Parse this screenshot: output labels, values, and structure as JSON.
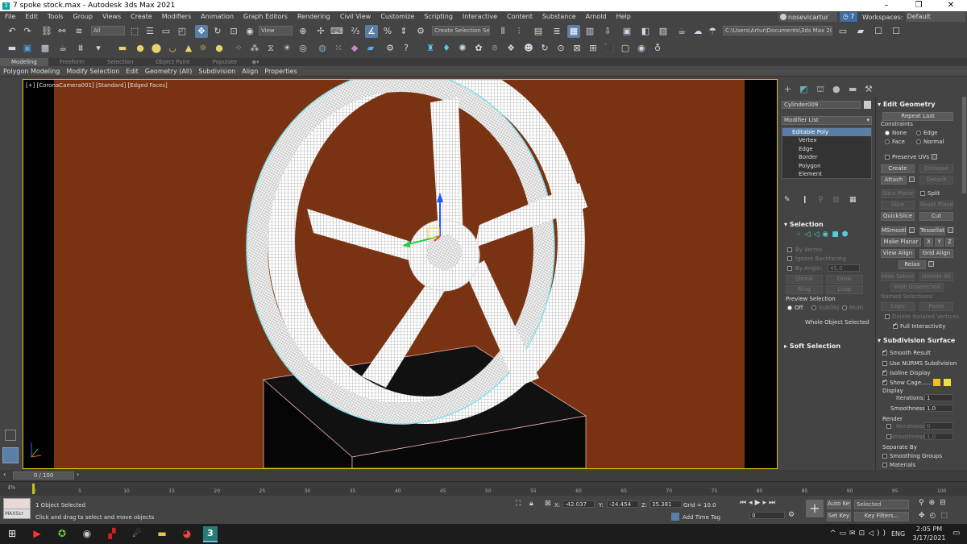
{
  "window": {
    "title": "7 spoke stock.max - Autodesk 3ds Max 2021",
    "controls": [
      "–",
      "❐",
      "✕"
    ]
  },
  "menu": [
    "File",
    "Edit",
    "Tools",
    "Group",
    "Views",
    "Create",
    "Modifiers",
    "Animation",
    "Graph Editors",
    "Rendering",
    "Civil View",
    "Customize",
    "Scripting",
    "Interactive",
    "Content",
    "Substance",
    "Arnold",
    "Help"
  ],
  "user": {
    "name": "nosevicartur",
    "help_count": "7",
    "workspaces_label": "Workspaces:",
    "workspace": "Default"
  },
  "toolbar": {
    "filter": "All",
    "refcoord": "View",
    "selection_set": "Create Selection Se",
    "path": "C:\\Users\\Artur\\Documents\\3ds Max 2021"
  },
  "ribbon": {
    "tabs": [
      "Modeling",
      "Freeform",
      "Selection",
      "Object Paint",
      "Populate"
    ],
    "items": [
      "Polygon Modeling",
      "Modify Selection",
      "Edit",
      "Geometry (All)",
      "Subdivision",
      "Align",
      "Properties"
    ]
  },
  "viewport": {
    "label": "[+] [CoronaCamera001] [Standard] [Edged Faces]"
  },
  "command_panel": {
    "object_name": "Cylinder009",
    "modifier_list": "Modifier List",
    "stack": [
      "Editable Poly",
      "Vertex",
      "Edge",
      "Border",
      "Polygon",
      "Element"
    ],
    "selection": {
      "title": "Selection",
      "by_vertex": "By Vertex",
      "ignore_backfacing": "Ignore Backfacing",
      "by_angle": "By Angle:",
      "angle": "45.0",
      "shrink": "Shrink",
      "grow": "Grow",
      "ring": "Ring",
      "loop": "Loop",
      "preview": "Preview Selection",
      "off": "Off",
      "subobj": "SubObj",
      "multi": "Multi",
      "status": "Whole Object Selected"
    },
    "soft_selection": "Soft Selection",
    "edit_geometry": {
      "title": "Edit Geometry",
      "repeat_last": "Repeat Last",
      "constraints": "Constraints",
      "none": "None",
      "edge": "Edge",
      "face": "Face",
      "normal": "Normal",
      "preserve_uvs": "Preserve UVs",
      "create": "Create",
      "collapse": "Collapse",
      "attach": "Attach",
      "detach": "Detach",
      "slice_plane": "Slice Plane",
      "split": "Split",
      "slice": "Slice",
      "reset_plane": "Reset Plane",
      "quickslice": "QuickSlice",
      "cut": "Cut",
      "msmooth": "MSmooth",
      "tessellate": "Tessellate",
      "make_planar": "Make Planar",
      "x": "X",
      "y": "Y",
      "z": "Z",
      "view_align": "View Align",
      "grid_align": "Grid Align",
      "relax": "Relax",
      "hide_selected": "Hide Selected",
      "unhide_all": "Unhide All",
      "hide_unselected": "Hide Unselected",
      "named_selections": "Named Selections:",
      "copy": "Copy",
      "paste": "Paste",
      "delete_isolated": "Delete Isolated Vertices",
      "full_interactivity": "Full Interactivity"
    },
    "subdivision": {
      "title": "Subdivision Surface",
      "smooth_result": "Smooth Result",
      "use_nurms": "Use NURMS Subdivision",
      "isoline": "Isoline Display",
      "show_cage": "Show Cage......",
      "display": "Display",
      "iterations": "Iterations:",
      "iter_val": "1",
      "smoothness": "Smoothness:",
      "smooth_val": "1.0",
      "render": "Render",
      "r_iter_val": "0",
      "r_smooth_val": "1.0",
      "separate_by": "Separate By",
      "smoothing_groups": "Smoothing Groups",
      "materials": "Materials"
    }
  },
  "timeline": {
    "frame": "0 / 100",
    "ticks": [
      "0",
      "5",
      "10",
      "15",
      "20",
      "25",
      "30",
      "35",
      "40",
      "45",
      "50",
      "55",
      "60",
      "65",
      "70",
      "75",
      "80",
      "85",
      "90",
      "95",
      "100"
    ]
  },
  "status": {
    "maxscript": "MAXScr",
    "selected": "1 Object Selected",
    "prompt": "Click and drag to select and move objects",
    "x_label": "X:",
    "x": "-42.037",
    "y_label": "Y:",
    "y": "-24.454",
    "z_label": "Z:",
    "z": "35.381",
    "grid": "Grid = 10.0",
    "add_time_tag": "Add Time Tag",
    "auto_key": "Auto Key",
    "set_key": "Set Key",
    "selected_dd": "Selected",
    "key_filters": "Key Filters...",
    "frame": "0"
  },
  "taskbar": {
    "lang": "ENG",
    "time": "2:05 PM",
    "date": "3/17/2021"
  },
  "colors": {
    "viewport_bg": "#7a3312",
    "accent": "#5a7fa6",
    "selection_border": "#e0c000"
  }
}
